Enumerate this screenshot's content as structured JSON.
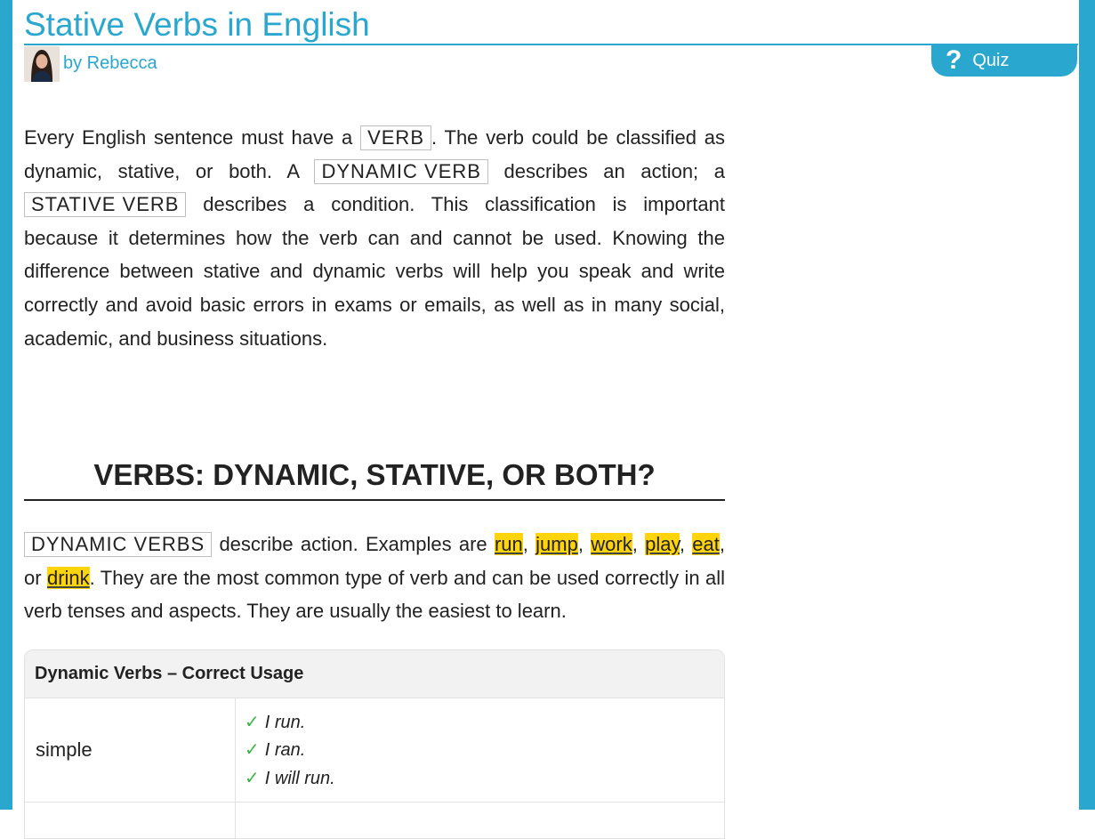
{
  "page": {
    "title": "Stative Verbs in English",
    "byline": "by Rebecca",
    "quiz": {
      "icon": "?",
      "label": "Quiz"
    }
  },
  "intro": {
    "t1": "Every English sentence must have a ",
    "tag_verb": "VERB",
    "t2": ". The verb could be classified as dynamic, stative, or both. A ",
    "tag_dynamic": "DYNAMIC VERB",
    "t3": " describes an action; a ",
    "tag_stative": "STATIVE VERB",
    "t4": " describes a condition. This classification is important because it determines how the verb can and cannot be used. Knowing the difference between stative and dynamic verbs will help you speak and write correctly and avoid basic errors in exams or emails, as well as in many social, academic, and business situations."
  },
  "section": {
    "heading": "VERBS: DYNAMIC, STATIVE, OR BOTH?",
    "tag": "DYNAMIC VERBS",
    "t1": " describe action. Examples are ",
    "examples": [
      "run",
      "jump",
      "work",
      "play",
      "eat",
      "drink"
    ],
    "sep_comma": ", ",
    "sep_or": ", or ",
    "t2": ". They are the most common type of verb and can be used correctly in all verb tenses and aspects. They are usually the easiest to learn."
  },
  "table": {
    "header": "Dynamic Verbs – Correct Usage",
    "check": "✓",
    "rows": [
      {
        "name": "simple",
        "examples": [
          "I run.",
          "I ran.",
          "I will run."
        ]
      }
    ]
  }
}
